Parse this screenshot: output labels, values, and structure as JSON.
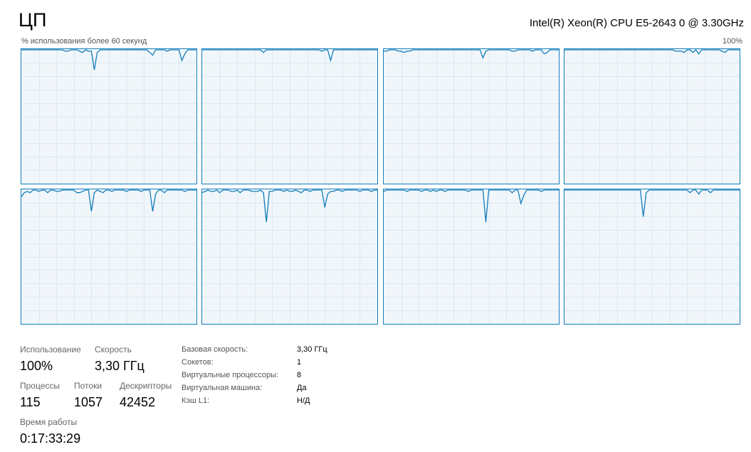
{
  "header": {
    "title": "ЦП",
    "cpu_name": "Intel(R) Xeon(R) CPU E5-2643 0 @ 3.30GHz",
    "caption_left": "% использования более 60 секунд",
    "caption_right": "100%"
  },
  "colors": {
    "line": "#117dbb",
    "grid": "#d9eaf4",
    "fill": "#f1f6fa"
  },
  "chart_data": {
    "type": "line",
    "ylim": [
      0,
      100
    ],
    "series": [
      {
        "values": [
          100,
          100,
          100,
          100,
          100,
          100,
          100,
          100,
          100,
          100,
          100,
          100,
          100,
          100,
          100,
          99,
          99,
          100,
          100,
          100,
          99,
          98,
          100,
          99,
          99,
          85,
          98,
          100,
          100,
          100,
          100,
          100,
          100,
          100,
          100,
          100,
          100,
          100,
          100,
          100,
          100,
          100,
          100,
          100,
          98,
          96,
          100,
          100,
          100,
          100,
          99,
          100,
          100,
          100,
          100,
          92,
          97,
          100,
          100,
          100,
          100
        ]
      },
      {
        "values": [
          100,
          100,
          100,
          100,
          100,
          100,
          100,
          100,
          100,
          100,
          100,
          100,
          100,
          100,
          100,
          100,
          100,
          100,
          100,
          100,
          100,
          98,
          100,
          100,
          100,
          100,
          100,
          100,
          100,
          100,
          100,
          100,
          100,
          100,
          100,
          100,
          100,
          100,
          100,
          100,
          100,
          99,
          100,
          100,
          92,
          100,
          100,
          100,
          100,
          100,
          100,
          100,
          100,
          100,
          100,
          100,
          100,
          100,
          100,
          100,
          100
        ]
      },
      {
        "values": [
          99,
          99,
          100,
          100,
          100,
          99,
          99,
          98,
          99,
          99,
          100,
          100,
          100,
          100,
          100,
          100,
          100,
          100,
          100,
          100,
          100,
          100,
          100,
          100,
          100,
          100,
          100,
          100,
          100,
          100,
          100,
          100,
          100,
          100,
          94,
          99,
          100,
          100,
          100,
          100,
          100,
          100,
          100,
          100,
          99,
          99,
          100,
          100,
          100,
          100,
          100,
          99,
          100,
          100,
          100,
          97,
          98,
          100,
          100,
          100,
          100
        ]
      },
      {
        "values": [
          100,
          100,
          100,
          100,
          100,
          100,
          100,
          100,
          100,
          100,
          100,
          100,
          100,
          100,
          100,
          100,
          100,
          100,
          100,
          100,
          100,
          100,
          100,
          100,
          100,
          100,
          100,
          100,
          100,
          100,
          100,
          100,
          100,
          100,
          100,
          100,
          100,
          100,
          99,
          99,
          99,
          98,
          100,
          100,
          98,
          100,
          97,
          100,
          100,
          100,
          100,
          100,
          100,
          100,
          99,
          98,
          100,
          100,
          100,
          100,
          100
        ]
      },
      {
        "values": [
          95,
          98,
          99,
          98,
          100,
          100,
          99,
          100,
          100,
          98,
          100,
          100,
          99,
          99,
          100,
          100,
          100,
          100,
          100,
          98,
          98,
          99,
          100,
          100,
          84,
          98,
          100,
          99,
          98,
          100,
          100,
          99,
          100,
          100,
          100,
          100,
          99,
          100,
          100,
          100,
          100,
          99,
          100,
          100,
          100,
          84,
          97,
          100,
          100,
          98,
          100,
          100,
          100,
          100,
          100,
          100,
          99,
          100,
          100,
          100,
          100
        ]
      },
      {
        "values": [
          98,
          99,
          100,
          99,
          99,
          100,
          98,
          100,
          100,
          100,
          99,
          99,
          100,
          98,
          100,
          100,
          100,
          99,
          99,
          99,
          100,
          98,
          76,
          99,
          99,
          100,
          100,
          100,
          99,
          100,
          99,
          99,
          100,
          99,
          98,
          100,
          100,
          99,
          100,
          100,
          100,
          100,
          87,
          97,
          99,
          99,
          100,
          100,
          99,
          100,
          100,
          100,
          100,
          100,
          99,
          100,
          100,
          100,
          99,
          100,
          100
        ]
      },
      {
        "values": [
          99,
          100,
          100,
          100,
          100,
          100,
          100,
          100,
          99,
          100,
          100,
          100,
          100,
          99,
          100,
          100,
          99,
          100,
          99,
          100,
          100,
          99,
          100,
          100,
          100,
          100,
          100,
          100,
          100,
          99,
          100,
          100,
          100,
          100,
          100,
          76,
          100,
          100,
          100,
          100,
          100,
          100,
          100,
          100,
          98,
          100,
          100,
          90,
          96,
          100,
          100,
          100,
          100,
          100,
          99,
          100,
          100,
          100,
          100,
          100,
          100
        ]
      },
      {
        "values": [
          100,
          100,
          100,
          100,
          100,
          100,
          100,
          100,
          100,
          100,
          100,
          100,
          100,
          100,
          100,
          100,
          100,
          100,
          100,
          100,
          100,
          100,
          100,
          100,
          100,
          100,
          100,
          80,
          98,
          100,
          100,
          100,
          100,
          100,
          100,
          100,
          100,
          100,
          100,
          100,
          100,
          100,
          100,
          98,
          100,
          100,
          97,
          100,
          100,
          100,
          98,
          100,
          100,
          100,
          100,
          100,
          100,
          100,
          100,
          100,
          100
        ]
      }
    ]
  },
  "stats": {
    "utilization": {
      "label": "Использование",
      "value": "100%"
    },
    "speed": {
      "label": "Скорость",
      "value": "3,30 ГГц"
    },
    "processes": {
      "label": "Процессы",
      "value": "115"
    },
    "threads": {
      "label": "Потоки",
      "value": "1057"
    },
    "handles": {
      "label": "Дескрипторы",
      "value": "42452"
    },
    "uptime": {
      "label": "Время работы",
      "value": "0:17:33:29"
    }
  },
  "info": [
    {
      "label": "Базовая скорость:",
      "value": "3,30 ГГц"
    },
    {
      "label": "Сокетов:",
      "value": "1"
    },
    {
      "label": "Виртуальные процессоры:",
      "value": "8"
    },
    {
      "label": "Виртуальная машина:",
      "value": "Да"
    },
    {
      "label": "Кэш L1:",
      "value": "Н/Д"
    }
  ]
}
